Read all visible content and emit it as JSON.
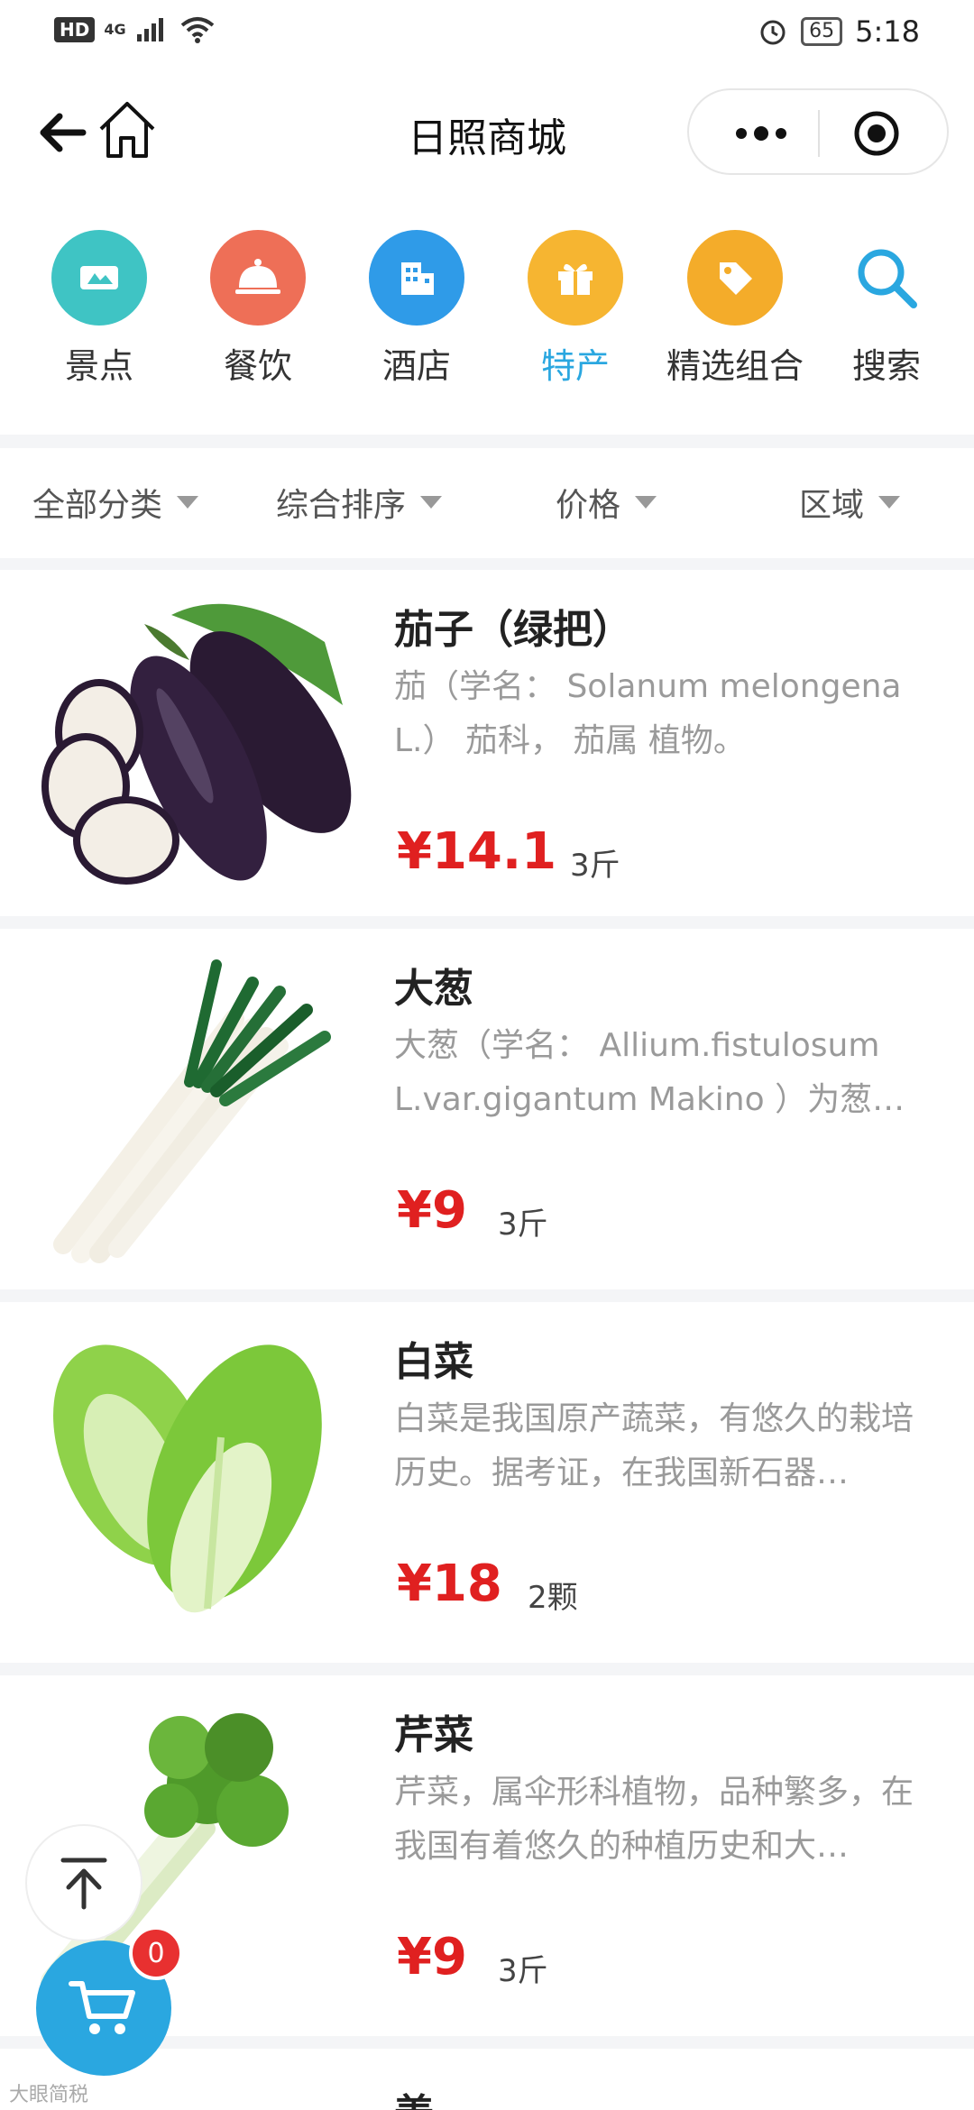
{
  "status_bar": {
    "network": "4G",
    "hd": "HD",
    "battery": "65",
    "time": "5:18"
  },
  "header": {
    "title": "日照商城"
  },
  "categories": [
    {
      "label": "景点",
      "color": "#3fc4c4"
    },
    {
      "label": "餐饮",
      "color": "#ee6f57"
    },
    {
      "label": "酒店",
      "color": "#2f9be8"
    },
    {
      "label": "特产",
      "color": "#f6b531"
    },
    {
      "label": "精选组合",
      "color": "#f4ac2a"
    },
    {
      "label": "搜索",
      "color": "#2aa7e0"
    }
  ],
  "filters": [
    "全部分类",
    "综合排序",
    "价格",
    "区域"
  ],
  "products": [
    {
      "name": "茄子（绿把）",
      "desc": "茄（学名： Solanum melongena L.） 茄科， 茄属 植物。",
      "price": "¥14.1",
      "unit": "3斤"
    },
    {
      "name": "大葱",
      "desc": "大葱（学名： Allium.fistulosum L.var.gigantum Makino ）为葱…",
      "price": "¥9",
      "unit": "3斤"
    },
    {
      "name": "白菜",
      "desc": "白菜是我国原产蔬菜，有悠久的栽培历史。据考证，在我国新石器…",
      "price": "¥18",
      "unit": "2颗"
    },
    {
      "name": "芹菜",
      "desc": "芹菜，属伞形科植物，品种繁多，在我国有着悠久的种植历史和大…",
      "price": "¥9",
      "unit": "3斤"
    }
  ],
  "peek_product": {
    "name": "姜"
  },
  "cart": {
    "count": "0"
  },
  "watermark": "大眼简税",
  "colors": {
    "accent": "#2aa7e0",
    "price": "#e02020"
  }
}
